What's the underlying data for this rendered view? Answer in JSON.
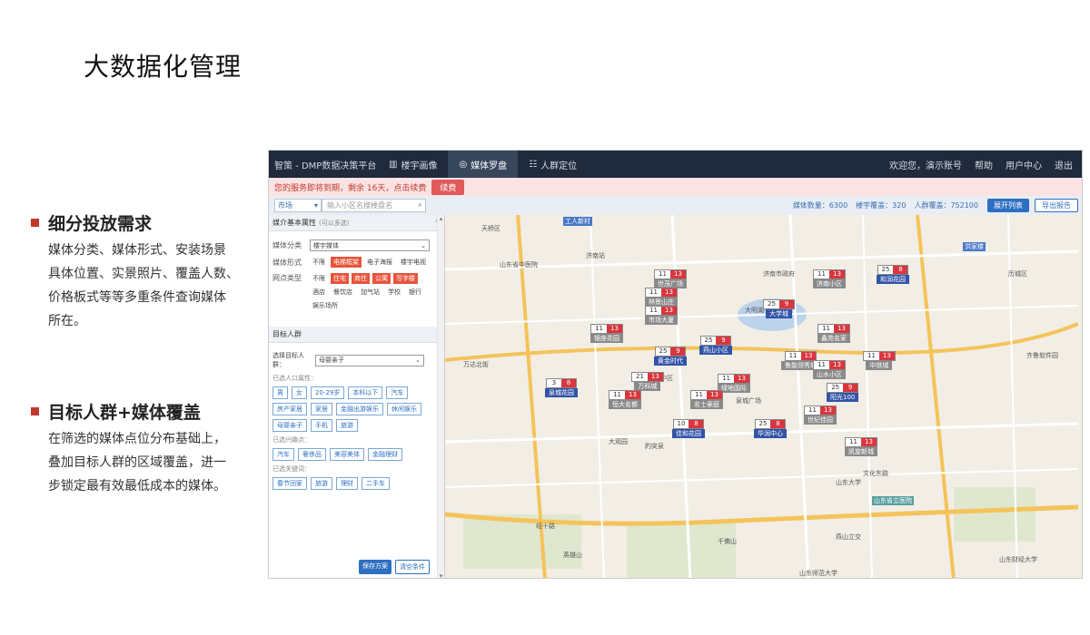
{
  "slide": {
    "title": "大数据化管理",
    "sections": [
      {
        "heading": "细分投放需求",
        "body": "媒体分类、媒体形式、安装场景 具体位置、实景照片、覆盖人数、 价格板式等等多重条件查询媒体 所在。"
      },
      {
        "heading": "目标人群+媒体覆盖",
        "body": "在筛选的媒体点位分布基础上， 叠加目标人群的区域覆盖，进一 步锁定最有效最低成本的媒体。"
      }
    ]
  },
  "app": {
    "brand": "智策 - DMP数据决策平台",
    "nav": [
      {
        "icon": "chart-icon",
        "label": "楼宇画像",
        "active": false
      },
      {
        "icon": "compass-icon",
        "label": "媒体罗盘",
        "active": true
      },
      {
        "icon": "people-icon",
        "label": "人群定位",
        "active": false
      }
    ],
    "user_links": [
      "欢迎您，演示账号",
      "帮助",
      "用户中心",
      "退出"
    ],
    "alert": {
      "text": "您的服务即将到期，剩余 16天，点击续费",
      "button": "续费"
    },
    "search": {
      "category": "市场",
      "placeholder": "输入小区名搜楼盘名",
      "stats": [
        "媒体数量：6300",
        "楼宇覆盖：320",
        "人群覆盖：752100"
      ],
      "btn_list": "展开列表",
      "btn_export": "导出报告"
    },
    "panel": {
      "basic_header": "媒介基本属性",
      "basic_sub": "(可以多选)",
      "media_class_label": "媒体分类",
      "media_class_value": "楼宇媒体",
      "media_form_label": "媒体形式",
      "media_forms": [
        {
          "label": "不限",
          "on": false
        },
        {
          "label": "电梯框架",
          "on": true
        },
        {
          "label": "电子海报",
          "on": false
        },
        {
          "label": "楼宇电视",
          "on": false
        }
      ],
      "site_type_label": "网点类型",
      "site_types": [
        {
          "label": "不限",
          "on": false
        },
        {
          "label": "住宅",
          "on": true
        },
        {
          "label": "商住",
          "on": true
        },
        {
          "label": "公寓",
          "on": true
        },
        {
          "label": "写字楼",
          "on": true
        },
        {
          "label": "酒店",
          "on": false
        },
        {
          "label": "餐饮店",
          "on": false
        },
        {
          "label": "加气站",
          "on": false
        },
        {
          "label": "学校",
          "on": false
        },
        {
          "label": "银行",
          "on": false
        },
        {
          "label": "娱乐场所",
          "on": false
        }
      ],
      "target_header": "目标人群",
      "target_label": "选择目标人群：",
      "target_value": "母婴亲子",
      "selected_attr_label": "已选人口属性：",
      "attr_tags": [
        "男",
        "女",
        "20-29岁",
        "本科以下",
        "汽车",
        "房产家居",
        "家居",
        "金融出游娱乐",
        "休闲娱乐",
        "母婴亲子",
        "手机",
        "旅游"
      ],
      "selected_interest_label": "已选兴趣点：",
      "interest_tags": [
        "汽车",
        "奢侈品",
        "美容美体",
        "金融理财"
      ],
      "selected_habit_label": "已选关键词：",
      "habit_tags": [
        "春节回家",
        "旅游",
        "理财",
        "二手车"
      ],
      "btn_save": "保存方案",
      "btn_clear": "清空条件"
    },
    "map": {
      "labels": [
        "工人新村",
        "天桥区",
        "山东省中医院",
        "历城区",
        "济南站",
        "万达北街",
        "历下区",
        "市中区",
        "趵突泉",
        "千佛山",
        "大观园",
        "山东大学",
        "燕山立交",
        "经十路",
        "山东省立医院",
        "泉城广场",
        "山东师范大学",
        "文化东路",
        "济南市政府",
        "洪家楼",
        "齐鲁软件园",
        "大明湖",
        "英雄山",
        "山东财经大学"
      ],
      "markers": [
        {
          "a": "11",
          "b": "13",
          "name": "世茂广场"
        },
        {
          "a": "11",
          "b": "13",
          "name": "林景山庄"
        },
        {
          "a": "11",
          "b": "13",
          "name": "济南小区"
        },
        {
          "a": "25",
          "b": "8",
          "name": "和润花园",
          "blue": true
        },
        {
          "a": "11",
          "b": "13",
          "name": "市场大厦"
        },
        {
          "a": "25",
          "b": "9",
          "name": "大学城",
          "blue": true
        },
        {
          "a": "11",
          "b": "13",
          "name": "鑫苑名家"
        },
        {
          "a": "11",
          "b": "13",
          "name": "银座花园"
        },
        {
          "a": "25",
          "b": "9",
          "name": "燕山小区",
          "blue": true
        },
        {
          "a": "11",
          "b": "13",
          "name": "中铁城"
        },
        {
          "a": "25",
          "b": "9",
          "name": "黄金时代",
          "blue": true
        },
        {
          "a": "11",
          "b": "13",
          "name": "鲁能领秀城"
        },
        {
          "a": "3",
          "b": "8",
          "name": "泉城花园",
          "blue": true
        },
        {
          "a": "21",
          "b": "13",
          "name": "万科城"
        },
        {
          "a": "11",
          "b": "13",
          "name": "绿地国际"
        },
        {
          "a": "11",
          "b": "13",
          "name": "恒大名都"
        },
        {
          "a": "25",
          "b": "9",
          "name": "阳光100",
          "blue": true
        },
        {
          "a": "11",
          "b": "13",
          "name": "山水小区"
        },
        {
          "a": "11",
          "b": "13",
          "name": "名士豪庭"
        },
        {
          "a": "10",
          "b": "8",
          "name": "佳和花园",
          "blue": true
        },
        {
          "a": "25",
          "b": "8",
          "name": "华润中心",
          "blue": true
        },
        {
          "a": "11",
          "b": "13",
          "name": "世纪佳园"
        },
        {
          "a": "11",
          "b": "13",
          "name": "凯旋新城"
        }
      ]
    }
  }
}
